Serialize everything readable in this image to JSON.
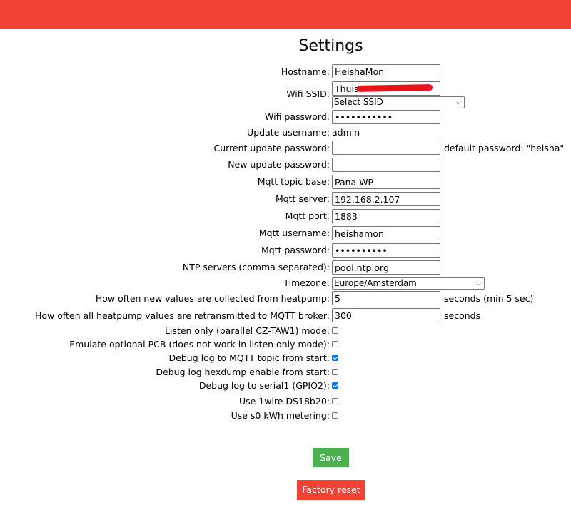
{
  "page": {
    "title": "Settings"
  },
  "colors": {
    "accent": "#f44336",
    "save": "#4caf50",
    "checkbox_on": "#0075ff"
  },
  "fields": {
    "hostname": {
      "label": "Hostname:",
      "value": "HeishaMon"
    },
    "wifi_ssid": {
      "label": "Wifi SSID:",
      "value": "Thuis",
      "select": "Select SSID"
    },
    "wifi_password": {
      "label": "Wifi password:",
      "value": "•••••••••••"
    },
    "update_username": {
      "label": "Update username:",
      "value": "admin"
    },
    "current_update_password": {
      "label": "Current update password:",
      "value": "",
      "note": "default password: \"heisha\""
    },
    "new_update_password": {
      "label": "New update password:",
      "value": ""
    },
    "mqtt_topic_base": {
      "label": "Mqtt topic base:",
      "value": "Pana WP"
    },
    "mqtt_server": {
      "label": "Mqtt server:",
      "value": "192.168.2.107"
    },
    "mqtt_port": {
      "label": "Mqtt port:",
      "value": "1883"
    },
    "mqtt_username": {
      "label": "Mqtt username:",
      "value": "heishamon"
    },
    "mqtt_password": {
      "label": "Mqtt password:",
      "value": "••••••••••"
    },
    "ntp_servers": {
      "label": "NTP servers (comma separated):",
      "value": "pool.ntp.org"
    },
    "timezone": {
      "label": "Timezone:",
      "value": "Europe/Amsterdam"
    },
    "collect_interval": {
      "label": "How often new values are collected from heatpump:",
      "value": "5",
      "note": "seconds (min 5 sec)"
    },
    "retransmit_interval": {
      "label": "How often all heatpump values are retransmitted to MQTT broker:",
      "value": "300",
      "note": "seconds"
    }
  },
  "checkboxes": [
    {
      "label": "Listen only (parallel CZ-TAW1) mode:",
      "checked": false
    },
    {
      "label": "Emulate optional PCB (does not work in listen only mode):",
      "checked": false
    },
    {
      "label": "Debug log to MQTT topic from start:",
      "checked": true
    },
    {
      "label": "Debug log hexdump enable from start:",
      "checked": false
    },
    {
      "label": "Debug log to serial1 (GPIO2):",
      "checked": true
    },
    {
      "label": "Use 1wire DS18b20:",
      "checked": false
    },
    {
      "label": "Use s0 kWh metering:",
      "checked": false
    }
  ],
  "buttons": {
    "save": "Save",
    "factory_reset": "Factory reset"
  }
}
